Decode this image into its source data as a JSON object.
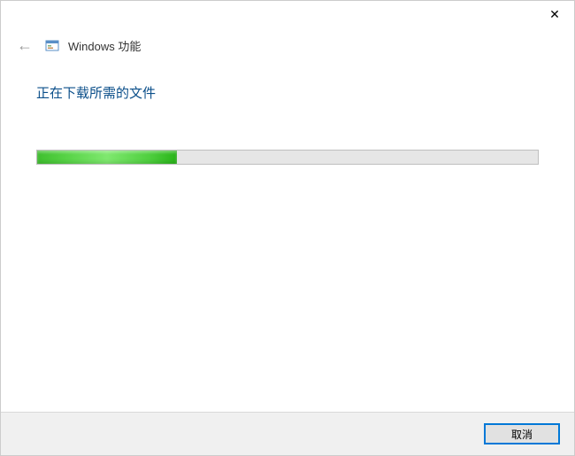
{
  "header": {
    "title": "Windows 功能"
  },
  "content": {
    "status_text": "正在下载所需的文件",
    "progress_percent": 28
  },
  "footer": {
    "cancel_label": "取消"
  }
}
